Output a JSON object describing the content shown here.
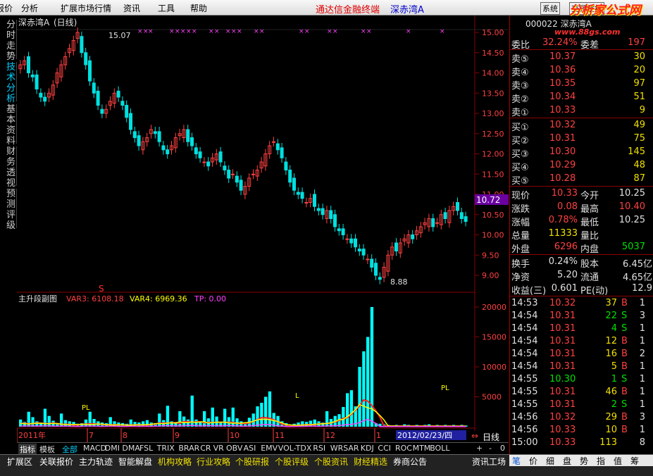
{
  "menu": {
    "items": [
      "报价",
      "分析",
      "扩展市场行情",
      "资讯",
      "工具",
      "帮助"
    ],
    "brand": "通达信金融终端",
    "stock_title": "深赤湾A",
    "btn_system": "系统",
    "btn_trade": "交易委托",
    "logo": "分析家公式网",
    "logo_url": "www.88gs.com"
  },
  "side_tabs": [
    "分时走势",
    "技术分析",
    "基本资料",
    "财务透视",
    "预测评级"
  ],
  "chart_header": {
    "name": "深赤湾A",
    "period": "(日线)"
  },
  "price_axis": [
    "15.00",
    "14.50",
    "14.00",
    "13.50",
    "13.00",
    "12.50",
    "12.00",
    "11.50",
    "11.00",
    "10.50",
    "10.00",
    "9.50",
    "9.00"
  ],
  "current_price_tag": "10.72",
  "high_mark": "15.07",
  "low_mark": "8.88",
  "s_mark": "S",
  "indicator": {
    "title": "主升段副图",
    "var3": "VAR3: 6108.18",
    "var4": "VAR4: 6969.36",
    "tp": "TP: 0.00",
    "axis": [
      "20000",
      "15000",
      "10000",
      "5000"
    ],
    "pl_label": "PL",
    "l_label": "L",
    "x_labels": [
      "2011年",
      "7",
      "8",
      "9",
      "10",
      "11",
      "12",
      "1"
    ],
    "date_box": "2012/02/23/四"
  },
  "bottom_tabs": {
    "left": [
      "指标",
      "模板",
      "全部"
    ],
    "indicators": [
      "MACD",
      "DMI",
      "DMA",
      "FSL",
      "TRIX",
      "BRAR",
      "CR",
      "VR",
      "OBV",
      "ASI",
      "EMV",
      "VOL-TDX",
      "RSI",
      "WR",
      "SAR",
      "KDJ",
      "CCI",
      "ROC",
      "MTM",
      "BOLL"
    ],
    "pm": [
      "+",
      "-",
      "0"
    ],
    "period": "日线"
  },
  "bottom_bar": {
    "items": [
      "扩展区",
      "关联报价",
      "主力轨迹",
      "智能解盘",
      "机构攻略",
      "行业攻略",
      "个股研报",
      "个股评级",
      "个股资讯",
      "财经精选",
      "券商公告",
      "资讯工场"
    ],
    "right_tabs": [
      "笔",
      "价",
      "细",
      "盘",
      "势",
      "指",
      "值",
      "筹"
    ]
  },
  "quote": {
    "code_title": "000022 深赤湾A",
    "weibi_label": "委比",
    "weibi": "32.24%",
    "weicha_label": "委差",
    "weicha": "197",
    "asks": [
      {
        "label": "卖⑤",
        "price": "10.37",
        "vol": "30"
      },
      {
        "label": "卖④",
        "price": "10.36",
        "vol": "20"
      },
      {
        "label": "卖③",
        "price": "10.35",
        "vol": "97"
      },
      {
        "label": "卖②",
        "price": "10.34",
        "vol": "51"
      },
      {
        "label": "卖①",
        "price": "10.33",
        "vol": "9"
      }
    ],
    "bids": [
      {
        "label": "买①",
        "price": "10.32",
        "vol": "49"
      },
      {
        "label": "买②",
        "price": "10.31",
        "vol": "75"
      },
      {
        "label": "买③",
        "price": "10.30",
        "vol": "145"
      },
      {
        "label": "买④",
        "price": "10.29",
        "vol": "48"
      },
      {
        "label": "买⑤",
        "price": "10.28",
        "vol": "87"
      }
    ],
    "stats": [
      {
        "l1": "现价",
        "v1": "10.33",
        "c1": "r",
        "l2": "今开",
        "v2": "10.25",
        "c2": "w"
      },
      {
        "l1": "涨跌",
        "v1": "0.08",
        "c1": "r",
        "l2": "最高",
        "v2": "10.40",
        "c2": "r"
      },
      {
        "l1": "涨幅",
        "v1": "0.78%",
        "c1": "r",
        "l2": "最低",
        "v2": "10.25",
        "c2": "w"
      },
      {
        "l1": "总量",
        "v1": "11333",
        "c1": "y",
        "l2": "量比",
        "v2": "",
        "c2": "w"
      },
      {
        "l1": "外盘",
        "v1": "6296",
        "c1": "r",
        "l2": "内盘",
        "v2": "5037",
        "c2": "g"
      }
    ],
    "stats2": [
      {
        "l1": "换手",
        "v1": "0.24%",
        "l2": "股本",
        "v2": "6.45亿"
      },
      {
        "l1": "净资",
        "v1": "5.20",
        "l2": "流通",
        "v2": "4.65亿"
      },
      {
        "l1": "收益(三)",
        "v1": "0.601",
        "l2": "PE(动)",
        "v2": "12.9"
      }
    ],
    "ticks": [
      {
        "t": "14:53",
        "p": "10.32",
        "v": "37",
        "bs": "B",
        "n": "1"
      },
      {
        "t": "14:54",
        "p": "10.31",
        "v": "22",
        "bs": "S",
        "n": "3"
      },
      {
        "t": "14:54",
        "p": "10.31",
        "v": "4",
        "bs": "S",
        "n": "1"
      },
      {
        "t": "14:54",
        "p": "10.31",
        "v": "12",
        "bs": "B",
        "n": "1"
      },
      {
        "t": "14:54",
        "p": "10.31",
        "v": "16",
        "bs": "B",
        "n": "2"
      },
      {
        "t": "14:54",
        "p": "10.31",
        "v": "5",
        "bs": "B",
        "n": "1"
      },
      {
        "t": "14:55",
        "p": "10.30",
        "v": "1",
        "bs": "S",
        "n": "1"
      },
      {
        "t": "14:55",
        "p": "10.31",
        "v": "46",
        "bs": "B",
        "n": "1"
      },
      {
        "t": "14:55",
        "p": "10.31",
        "v": "2",
        "bs": "S",
        "n": "1"
      },
      {
        "t": "14:56",
        "p": "10.32",
        "v": "29",
        "bs": "B",
        "n": "3"
      },
      {
        "t": "14:56",
        "p": "10.33",
        "v": "10",
        "bs": "B",
        "n": "1"
      },
      {
        "t": "15:00",
        "p": "10.33",
        "v": "113",
        "bs": "",
        "n": "8"
      }
    ]
  },
  "colors": {
    "up": "#ff4040",
    "down": "#00e0e0",
    "grid": "#8b0000",
    "yellow": "#ffff00",
    "magenta": "#ff40ff",
    "cyan": "#00ffff",
    "red": "#ff2020"
  },
  "chart_data": {
    "type": "candlestick",
    "closes": [
      14.2,
      14.3,
      14.0,
      13.9,
      13.6,
      13.4,
      13.3,
      13.5,
      13.7,
      14.0,
      14.2,
      14.4,
      14.6,
      14.8,
      15.0,
      14.5,
      14.2,
      13.8,
      13.5,
      13.2,
      13.0,
      13.1,
      13.3,
      13.5,
      13.4,
      13.2,
      12.9,
      12.6,
      12.4,
      12.2,
      12.3,
      12.4,
      12.6,
      12.5,
      12.3,
      12.1,
      12.0,
      12.2,
      12.4,
      12.5,
      12.6,
      12.3,
      12.2,
      12.0,
      11.9,
      11.8,
      11.7,
      11.9,
      12.0,
      11.8,
      11.6,
      11.4,
      11.5,
      11.3,
      11.1,
      11.2,
      11.4,
      11.5,
      11.6,
      11.8,
      12.0,
      12.2,
      12.3,
      12.1,
      11.9,
      11.6,
      11.3,
      11.1,
      11.0,
      10.9,
      10.8,
      10.9,
      10.7,
      10.6,
      10.5,
      10.6,
      10.4,
      10.2,
      10.1,
      10.0,
      9.9,
      9.8,
      9.7,
      9.6,
      9.5,
      9.4,
      9.2,
      9.0,
      8.9,
      9.2,
      9.5,
      9.7,
      9.6,
      9.8,
      9.9,
      10.0,
      9.9,
      10.1,
      10.2,
      10.3,
      10.4,
      10.2,
      10.3,
      10.5,
      10.4,
      10.6,
      10.7,
      10.6,
      10.4,
      10.33
    ],
    "volume": [
      1200,
      800,
      2500,
      1600,
      900,
      700,
      3000,
      1800,
      1000,
      600,
      2200,
      1100,
      900,
      800,
      500,
      600,
      1200,
      2500,
      1300,
      900,
      700,
      600,
      1600,
      900,
      700,
      600,
      500,
      1200,
      800,
      700,
      900,
      1100,
      700,
      600,
      2200,
      1100,
      3500,
      900,
      800,
      2600,
      1700,
      1200,
      5200,
      1200,
      900,
      2600,
      1400,
      3200,
      1700,
      800,
      3000,
      1600,
      3200,
      1400,
      900,
      700,
      1500,
      2200,
      3400,
      4000,
      5000,
      5900,
      2300,
      1800,
      900,
      600,
      400,
      500,
      700,
      900,
      800,
      1000,
      1200,
      900,
      700,
      2600,
      1300,
      1800,
      2100,
      3300,
      5600,
      6100,
      3400,
      10000,
      12600,
      15000,
      20000,
      600,
      500,
      400,
      300,
      200,
      300,
      200,
      400,
      300,
      200,
      300,
      200,
      300,
      400,
      200,
      300,
      200,
      300,
      200,
      300,
      200,
      300,
      200
    ]
  }
}
